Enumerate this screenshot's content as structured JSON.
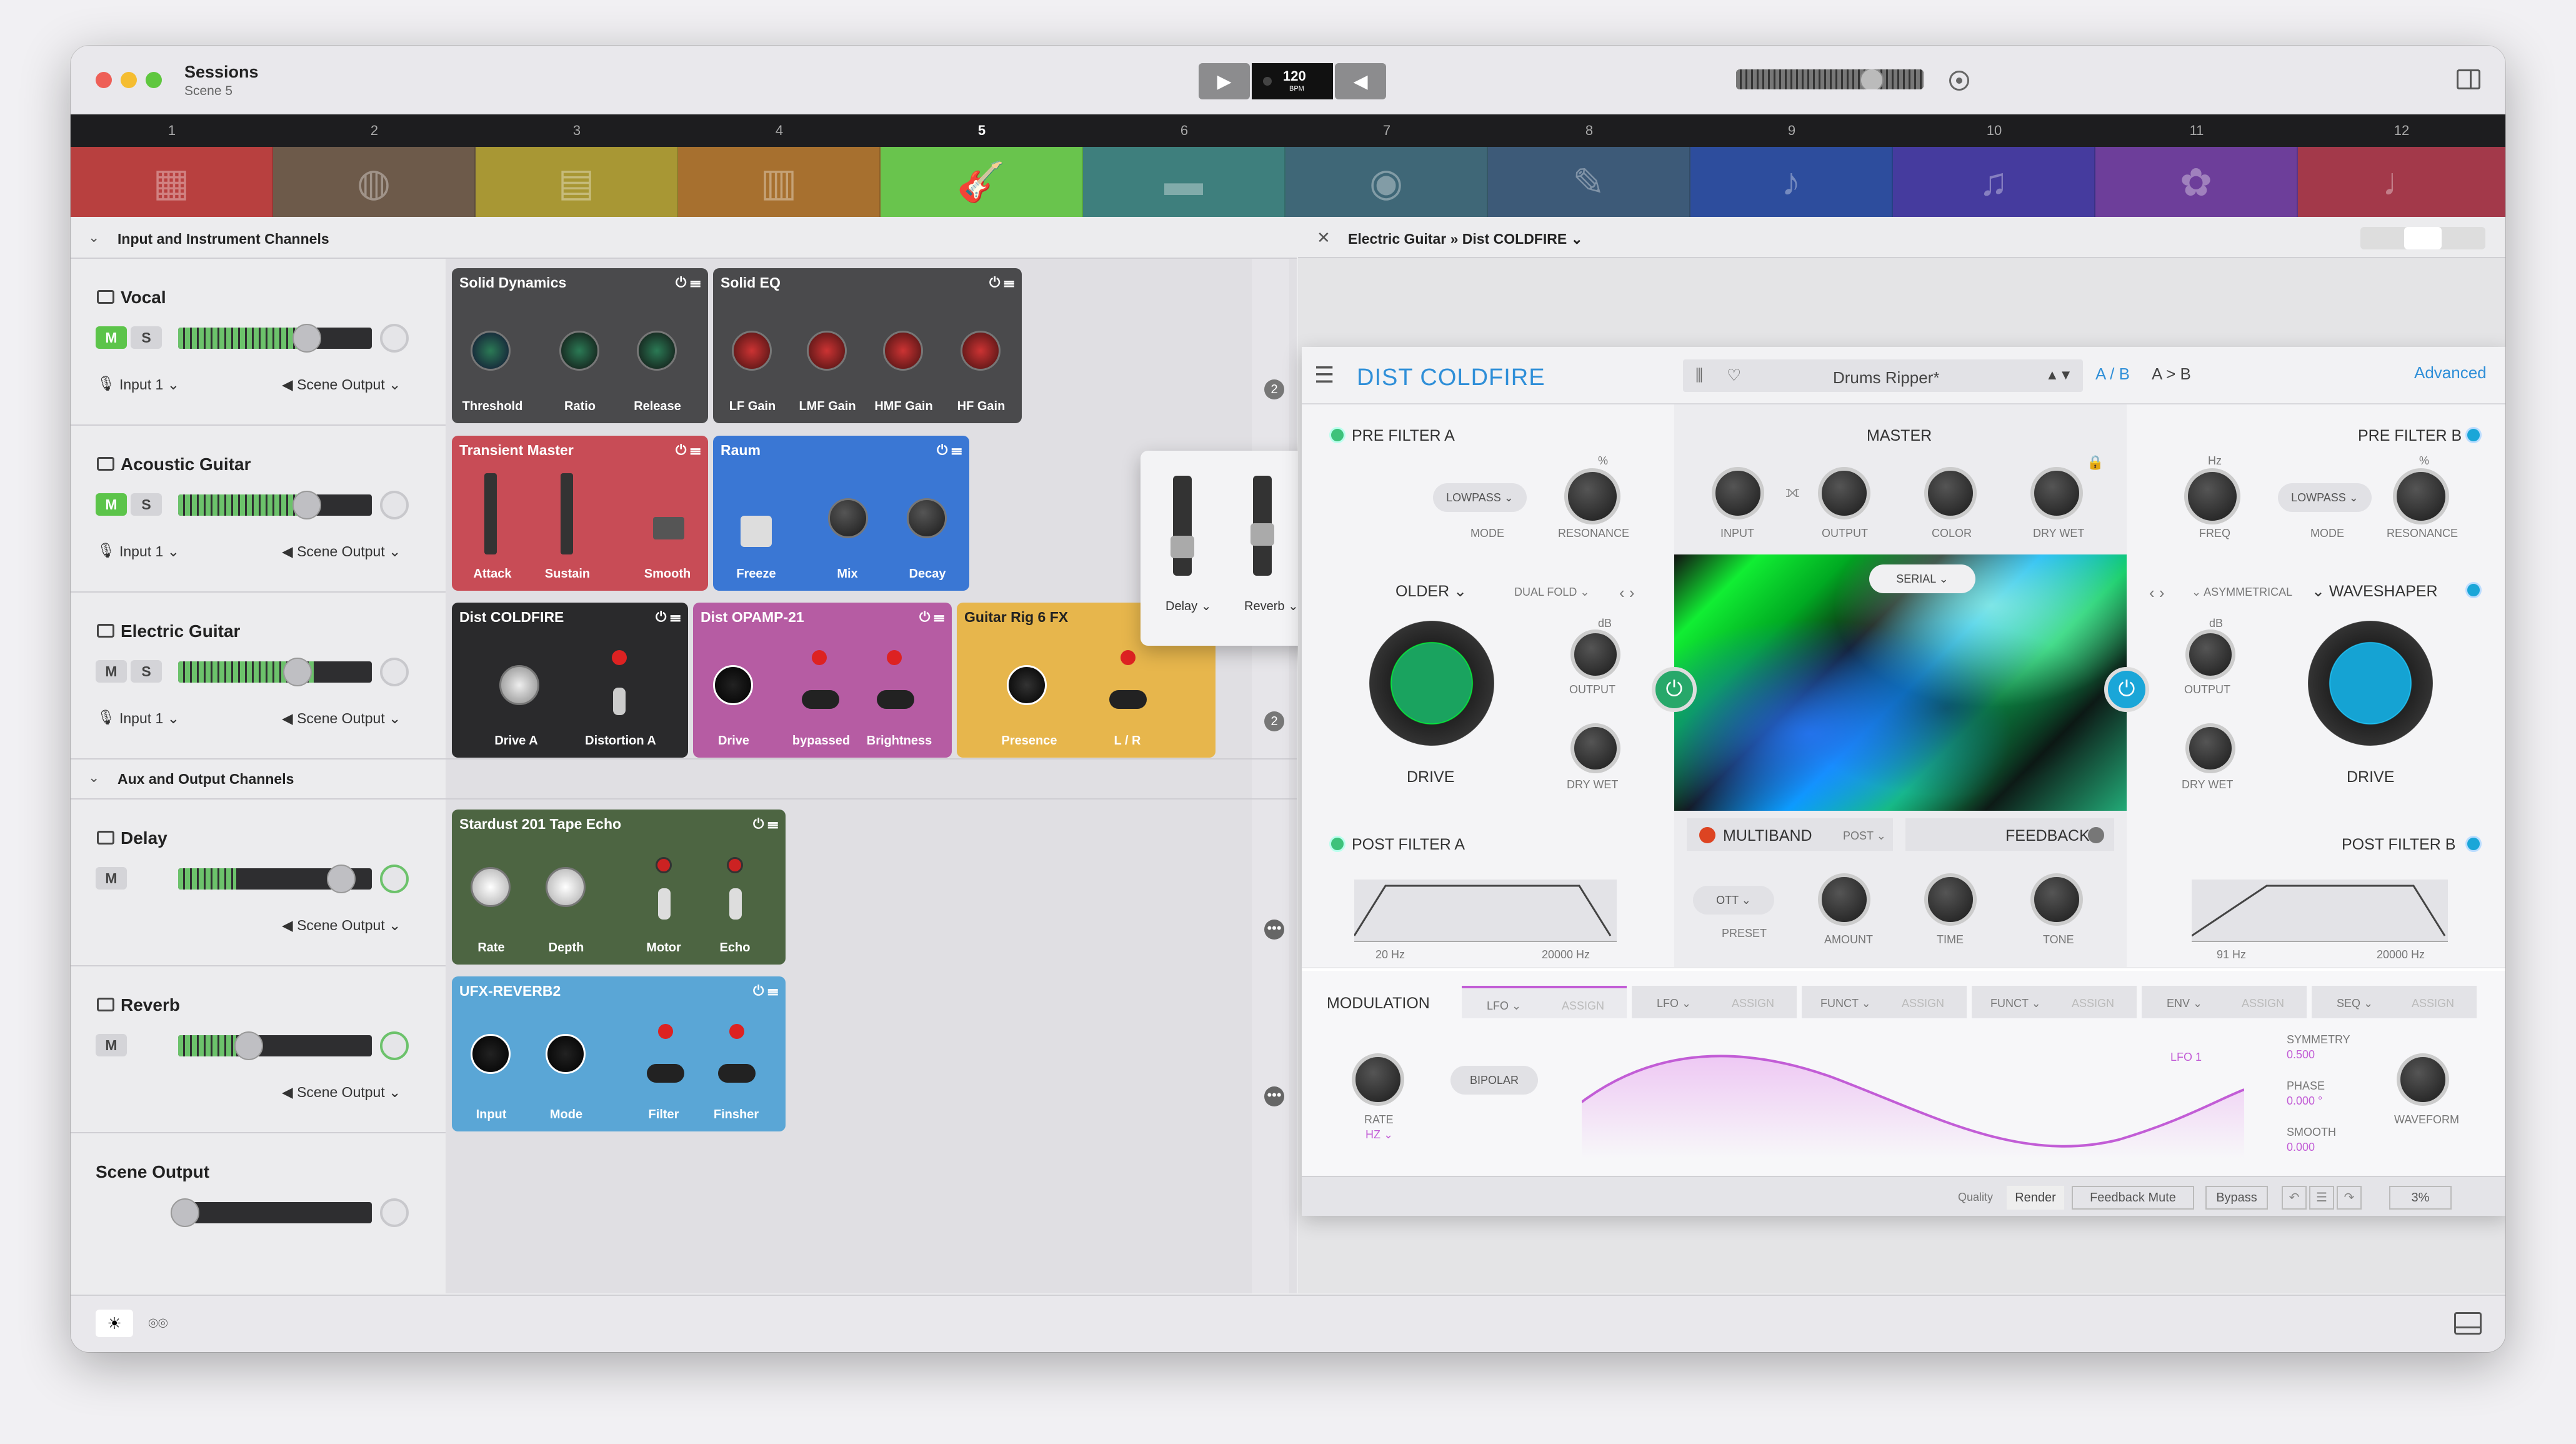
{
  "window": {
    "title": "Sessions",
    "subtitle": "Scene 5"
  },
  "transport": {
    "bpm": "120",
    "bpm_unit": "BPM"
  },
  "scene_numbers": [
    "1",
    "2",
    "3",
    "4",
    "5",
    "6",
    "7",
    "8",
    "9",
    "10",
    "11",
    "12"
  ],
  "scene_colors": [
    "#b8403f",
    "#6d5a4a",
    "#a89734",
    "#a7702f",
    "#69c44d",
    "#3e7f7d",
    "#3f6777",
    "#3d5a78",
    "#2d4d9d",
    "#453b9e",
    "#6d3e9a",
    "#a3394a"
  ],
  "scene_icons": [
    "piano-icon",
    "drums-icon",
    "keyboard-icon",
    "synth-icon",
    "guitar-icon",
    "amp-icon",
    "video-camera-icon",
    "microphone-icon",
    "trumpet-icon",
    "violin-icon",
    "ukulele-icon",
    "bass-icon"
  ],
  "sections": {
    "input": "Input and Instrument Channels",
    "aux": "Aux and Output Channels"
  },
  "tracks": [
    {
      "name": "Vocal",
      "input": "Input 1",
      "output": "Scene Output",
      "m": "M",
      "s": "S"
    },
    {
      "name": "Acoustic Guitar",
      "input": "Input 1",
      "output": "Scene Output",
      "m": "M",
      "s": "S"
    },
    {
      "name": "Electric Guitar",
      "input": "Input 1",
      "output": "Scene Output",
      "m": "M",
      "s": "S"
    },
    {
      "name": "Delay",
      "output": "Scene Output",
      "m": "M"
    },
    {
      "name": "Reverb",
      "output": "Scene Output",
      "m": "M"
    },
    {
      "name": "Scene Output"
    }
  ],
  "plugins": {
    "solid_dynamics": {
      "name": "Solid Dynamics",
      "labels": [
        "Threshold",
        "Ratio",
        "Release"
      ]
    },
    "solid_eq": {
      "name": "Solid EQ",
      "labels": [
        "LF Gain",
        "LMF Gain",
        "HMF Gain",
        "HF Gain"
      ]
    },
    "transient_master": {
      "name": "Transient Master",
      "labels": [
        "Attack",
        "Sustain",
        "Smooth"
      ]
    },
    "raum": {
      "name": "Raum",
      "labels": [
        "Freeze",
        "Mix",
        "Decay"
      ]
    },
    "dist_coldfire": {
      "name": "Dist COLDFIRE",
      "labels": [
        "Drive A",
        "Distortion A"
      ]
    },
    "dist_opamp": {
      "name": "Dist OPAMP-21",
      "labels": [
        "Drive",
        "bypassed",
        "Brightness"
      ]
    },
    "guitar_rig": {
      "name": "Guitar Rig 6 FX",
      "labels": [
        "Presence",
        "L / R"
      ]
    },
    "stardust": {
      "name": "Stardust 201 Tape Echo",
      "labels": [
        "Rate",
        "Depth",
        "Motor",
        "Echo"
      ]
    },
    "ufx_reverb": {
      "name": "UFX-REVERB2",
      "labels": [
        "Input",
        "Mode",
        "Filter",
        "Finsher"
      ]
    }
  },
  "send_popup": {
    "sends": [
      "Delay",
      "Reverb"
    ]
  },
  "badges": [
    "2",
    "2"
  ],
  "detail": {
    "breadcrumb": "Electric Guitar » Dist COLDFIRE"
  },
  "coldfire": {
    "title": "DIST COLDFIRE",
    "preset": "Drums Ripper*",
    "ab": "A / B",
    "a_to_b": "A > B",
    "advanced": "Advanced",
    "pre_filter_a": "PRE FILTER A",
    "pre_filter_b": "PRE FILTER B",
    "master": "MASTER",
    "lowpass": "LOWPASS",
    "mode": "MODE",
    "resonance": "RESONANCE",
    "freq": "FREQ",
    "pct": "%",
    "db": "dB",
    "hz": "Hz",
    "master_knobs": [
      "INPUT",
      "OUTPUT",
      "COLOR",
      "DRY WET"
    ],
    "folder": "OLDER",
    "dual_fold": "DUAL FOLD",
    "serial": "SERIAL",
    "asymmetrical": "ASYMMETRICAL",
    "waveshaper": "WAVESHAPER",
    "output": "OUTPUT",
    "dry_wet": "DRY WET",
    "drive": "DRIVE",
    "post_filter_a": "POST FILTER A",
    "post_filter_b": "POST FILTER B",
    "multiband": "MULTIBAND",
    "post": "POST",
    "feedback": "FEEDBACK",
    "ott": "OTT",
    "preset_lbl": "PRESET",
    "amount": "AMOUNT",
    "time": "TIME",
    "tone": "TONE",
    "pfa_lo": "20 Hz",
    "pfa_hi": "20000 Hz",
    "pfb_lo": "91 Hz",
    "pfb_hi": "20000 Hz",
    "modulation": "MODULATION",
    "mod_tabs": [
      "LFO",
      "LFO",
      "FUNCT",
      "FUNCT",
      "ENV",
      "SEQ"
    ],
    "assign": "ASSIGN",
    "rate": "RATE",
    "rate_unit": "HZ",
    "bipolar": "BIPOLAR",
    "lfo1": "LFO 1",
    "symmetry": "SYMMETRY",
    "symmetry_v": "0.500",
    "phase": "PHASE",
    "phase_v": "0.000 °",
    "smooth": "SMOOTH",
    "smooth_v": "0.000",
    "waveform": "WAVEFORM",
    "quality": "Quality",
    "render": "Render",
    "feedback_mute": "Feedback Mute",
    "bypass": "Bypass",
    "zoom": "3%"
  }
}
